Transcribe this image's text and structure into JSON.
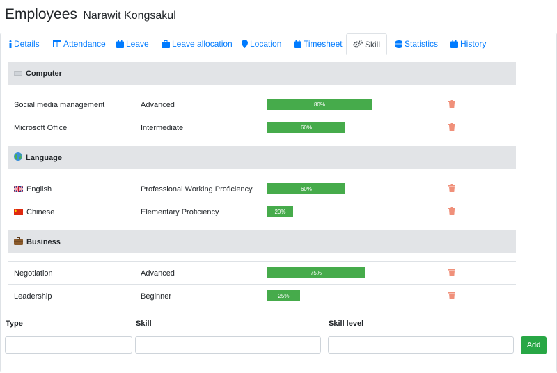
{
  "header": {
    "title": "Employees",
    "subtitle": "Narawit Kongsakul"
  },
  "tabs": [
    {
      "label": "Details",
      "icon": "info-icon"
    },
    {
      "label": "Attendance",
      "icon": "table-icon"
    },
    {
      "label": "Leave",
      "icon": "calendar-icon"
    },
    {
      "label": "Leave allocation",
      "icon": "briefcase-icon"
    },
    {
      "label": "Location",
      "icon": "map-marker-icon"
    },
    {
      "label": "Timesheet",
      "icon": "calendar-icon"
    },
    {
      "label": "Skill",
      "icon": "cogs-icon",
      "active": true
    },
    {
      "label": "Statistics",
      "icon": "database-icon"
    },
    {
      "label": "History",
      "icon": "calendar-icon"
    }
  ],
  "categories": [
    {
      "name": "Computer",
      "icon": "keyboard-icon",
      "skills": [
        {
          "name": "Social media management",
          "level": "Advanced",
          "percent": 80,
          "percent_label": "80%"
        },
        {
          "name": "Microsoft Office",
          "level": "Intermediate",
          "percent": 60,
          "percent_label": "60%"
        }
      ]
    },
    {
      "name": "Language",
      "icon": "globe-icon",
      "skills": [
        {
          "name": "English",
          "flag": "uk-flag-icon",
          "level": "Professional Working Proficiency",
          "percent": 60,
          "percent_label": "60%"
        },
        {
          "name": "Chinese",
          "flag": "china-flag-icon",
          "level": "Elementary Proficiency",
          "percent": 20,
          "percent_label": "20%"
        }
      ]
    },
    {
      "name": "Business",
      "icon": "briefcase-icon",
      "skills": [
        {
          "name": "Negotiation",
          "level": "Advanced",
          "percent": 75,
          "percent_label": "75%"
        },
        {
          "name": "Leadership",
          "level": "Beginner",
          "percent": 25,
          "percent_label": "25%"
        }
      ]
    }
  ],
  "form": {
    "type_label": "Type",
    "skill_label": "Skill",
    "skill_level_label": "Skill level",
    "type_value": "",
    "skill_value": "",
    "skill_level_value": "",
    "add_label": "Add"
  },
  "colors": {
    "link": "#007bff",
    "bar": "#46ab4b",
    "trash": "#f0907a",
    "add_button": "#28a745",
    "category_bg": "#e2e4e7"
  }
}
